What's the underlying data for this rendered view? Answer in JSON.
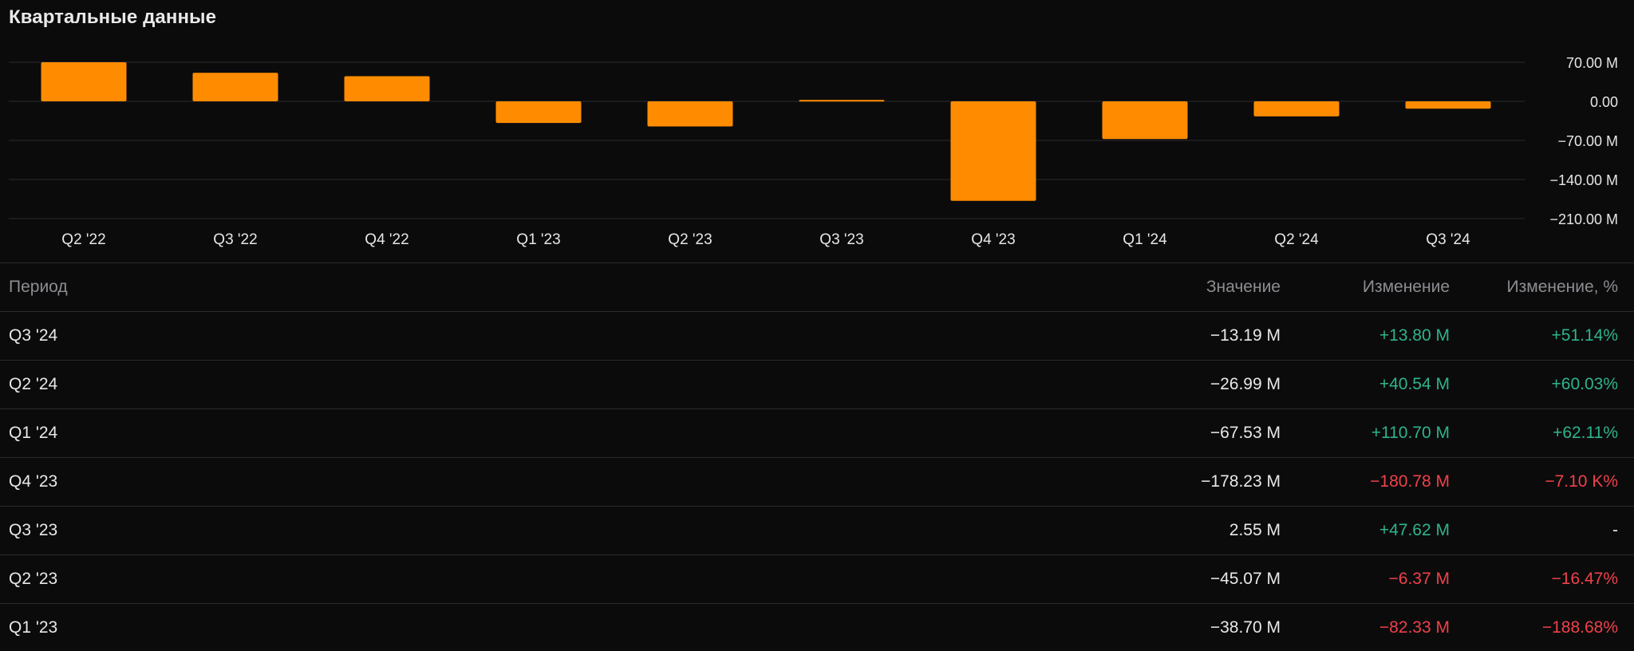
{
  "header": {
    "title": "Квартальные данные"
  },
  "colors": {
    "bar": "#ff8c00",
    "positive": "#2fb38b",
    "negative": "#f0414a",
    "grid": "#2b2b2f",
    "background": "#0b0b0c"
  },
  "chart_data": {
    "type": "bar",
    "title": "",
    "xlabel": "",
    "ylabel": "",
    "categories": [
      "Q2 '22",
      "Q3 '22",
      "Q4 '22",
      "Q1 '23",
      "Q2 '23",
      "Q3 '23",
      "Q4 '23",
      "Q1 '24",
      "Q2 '24",
      "Q3 '24"
    ],
    "values": [
      70.0,
      51.0,
      45.0,
      -38.7,
      -45.07,
      2.55,
      -178.23,
      -67.53,
      -26.99,
      -13.19
    ],
    "ylim": [
      -210,
      70
    ],
    "yticks": [
      70,
      0,
      -70,
      -140,
      -210
    ],
    "ytick_labels": [
      "70.00 M",
      "0.00",
      "−70.00 M",
      "−140.00 M",
      "−210.00 M"
    ],
    "grid": true,
    "legend": "none"
  },
  "table": {
    "columns": [
      "Период",
      "Значение",
      "Изменение",
      "Изменение, %"
    ],
    "rows": [
      {
        "period": "Q3 '24",
        "value": "−13.19 M",
        "change": "+13.80 M",
        "change_sign": "pos",
        "pct": "+51.14%",
        "pct_sign": "pos"
      },
      {
        "period": "Q2 '24",
        "value": "−26.99 M",
        "change": "+40.54 M",
        "change_sign": "pos",
        "pct": "+60.03%",
        "pct_sign": "pos"
      },
      {
        "period": "Q1 '24",
        "value": "−67.53 M",
        "change": "+110.70 M",
        "change_sign": "pos",
        "pct": "+62.11%",
        "pct_sign": "pos"
      },
      {
        "period": "Q4 '23",
        "value": "−178.23 M",
        "change": "−180.78 M",
        "change_sign": "neg",
        "pct": "−7.10 K%",
        "pct_sign": "neg"
      },
      {
        "period": "Q3 '23",
        "value": "2.55 M",
        "change": "+47.62 M",
        "change_sign": "pos",
        "pct": "-",
        "pct_sign": "none"
      },
      {
        "period": "Q2 '23",
        "value": "−45.07 M",
        "change": "−6.37 M",
        "change_sign": "neg",
        "pct": "−16.47%",
        "pct_sign": "neg"
      },
      {
        "period": "Q1 '23",
        "value": "−38.70 M",
        "change": "−82.33 M",
        "change_sign": "neg",
        "pct": "−188.68%",
        "pct_sign": "neg"
      }
    ]
  }
}
